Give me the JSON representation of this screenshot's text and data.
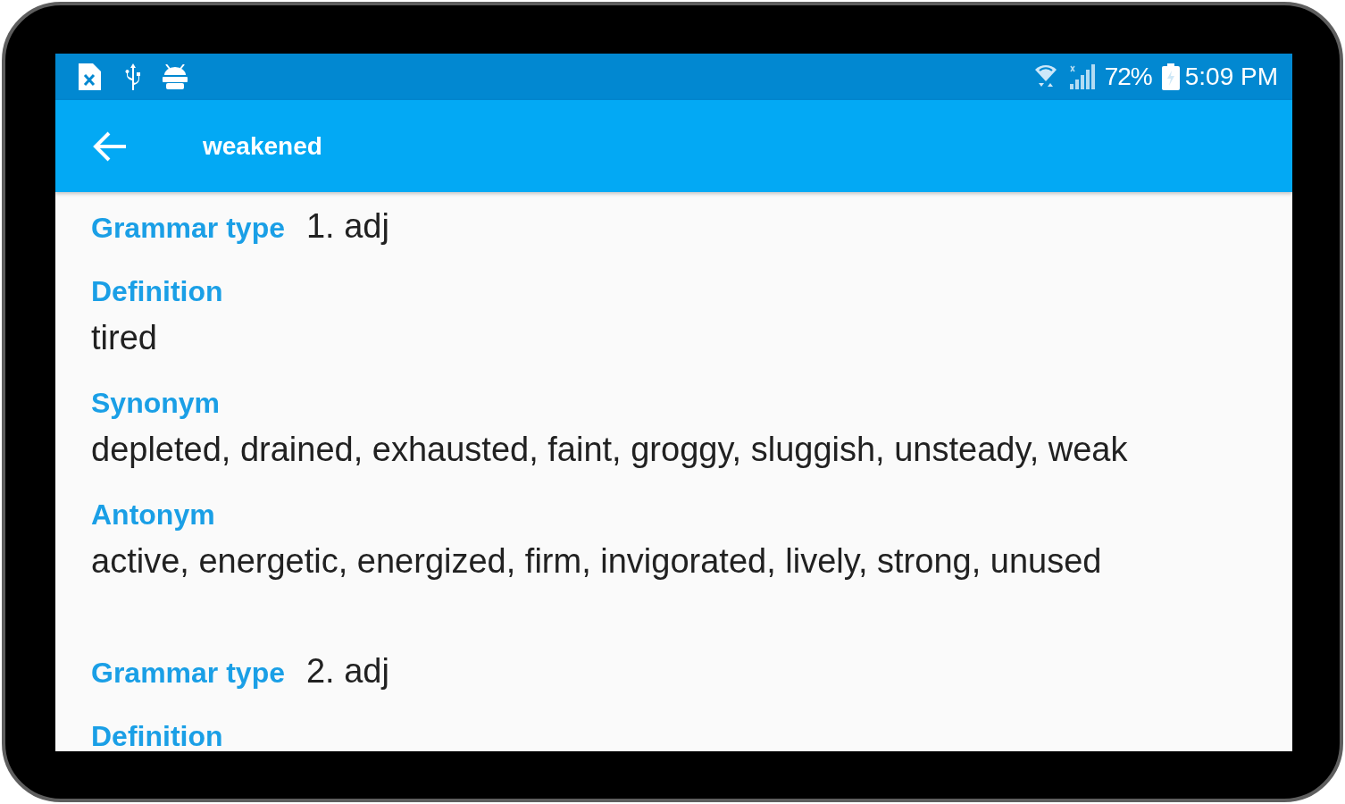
{
  "status_bar": {
    "battery": "72%",
    "time": "5:09 PM"
  },
  "app_bar": {
    "title": "weakened"
  },
  "senses": [
    {
      "grammar_label": "Grammar type",
      "grammar_value": "1. adj",
      "fields": [
        {
          "label": "Definition",
          "value": "tired"
        },
        {
          "label": "Synonym",
          "value": "depleted, drained, exhausted, faint, groggy, sluggish, unsteady, weak"
        },
        {
          "label": "Antonym",
          "value": "active, energetic, energized, firm, invigorated, lively, strong, unused"
        }
      ]
    },
    {
      "grammar_label": "Grammar type",
      "grammar_value": "2. adj",
      "fields": [
        {
          "label": "Definition"
        }
      ]
    }
  ]
}
